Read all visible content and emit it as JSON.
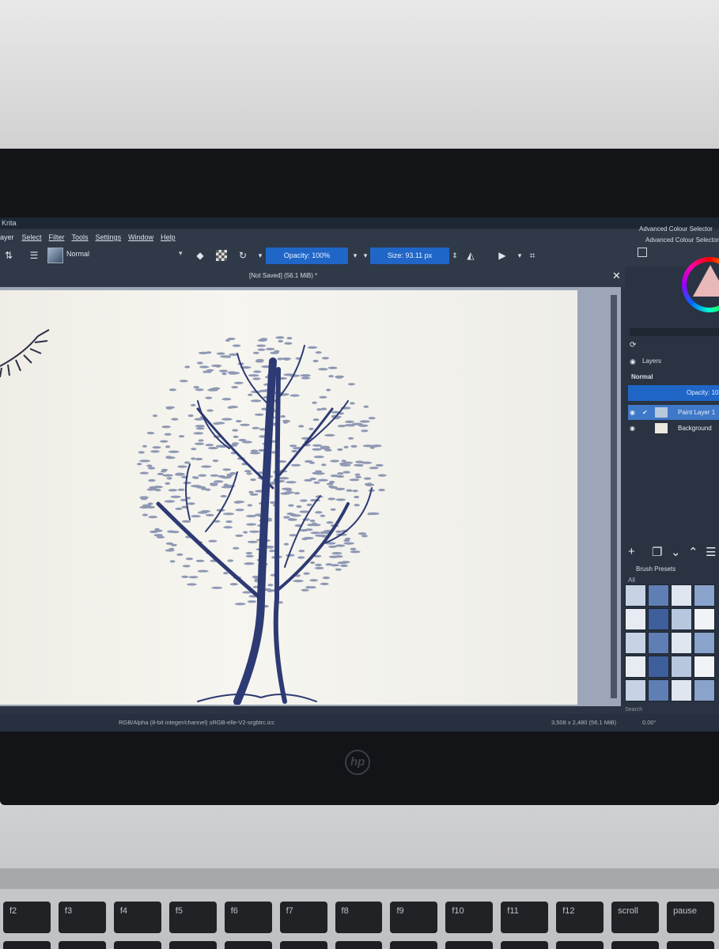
{
  "window": {
    "title": "Krita",
    "doc_title": "[Not Saved]  (56.1 MiB) *"
  },
  "menu": [
    "ayer",
    "Select",
    "Filter",
    "Tools",
    "Settings",
    "Window",
    "Help"
  ],
  "toolbar": {
    "blend_mode": "Normal",
    "opacity_label": "Opacity: 100%",
    "size_label": "Size: 93.11 px"
  },
  "dock": {
    "colour_selector_tab": "Advanced Colour Selector",
    "colour_selector_title": "Advanced Colour Selector",
    "layers_title": "Layers",
    "layers_blend": "Normal",
    "layers_opacity": "Opacity: 10",
    "layers": [
      {
        "name": "Paint Layer 1",
        "selected": true
      },
      {
        "name": "Background",
        "selected": false
      }
    ],
    "brush_presets_title": "Brush Presets",
    "brush_filter": "All",
    "search_label": "Search"
  },
  "status": {
    "color_space": "RGB/Alpha (8-bit integer/channel)  sRGB-elle-V2-srgbtrc.icc",
    "dimensions": "3,508 x 2,480 (56.1 MiB)",
    "rotation": "0.00°"
  },
  "laptop": {
    "brand_logo": "hp",
    "keys": [
      "f2",
      "f3",
      "f4",
      "f5",
      "f6",
      "f7",
      "f8",
      "f9",
      "f10",
      "f11",
      "f12",
      "scroll",
      "pause"
    ]
  },
  "colors": {
    "accent": "#1f66c7",
    "ui_dark": "#2f3948",
    "ink": "#2d3a73"
  }
}
